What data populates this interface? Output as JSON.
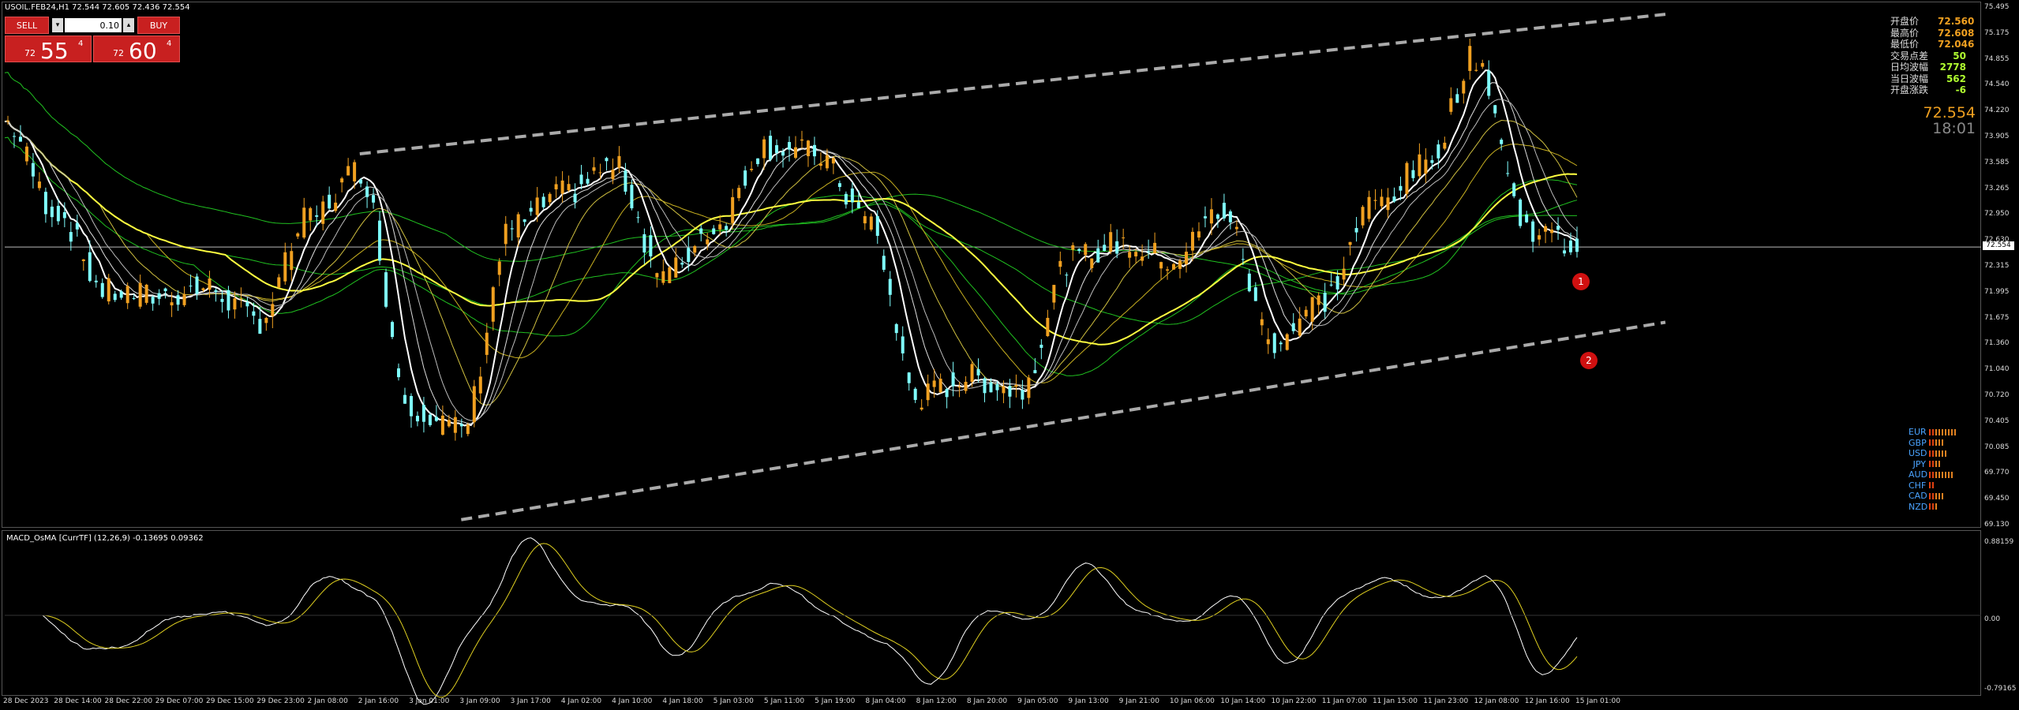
{
  "chart_title": "USOIL.FEB24,H1  72.544 72.605 72.436 72.554",
  "macd_title": "MACD_OsMA [CurrTF] (12,26,9) -0.13695 0.09362",
  "trade": {
    "sell_label": "SELL",
    "buy_label": "BUY",
    "lot": "0.10",
    "lot_down_icon": "▾",
    "lot_up_icon": "▴",
    "bid_small": "72",
    "bid_big": "55",
    "bid_sup": "4",
    "ask_small": "72",
    "ask_big": "60",
    "ask_sup": "4"
  },
  "stats": [
    {
      "label": "开盘价",
      "value": "72.560",
      "color": "#f0a020"
    },
    {
      "label": "最高价",
      "value": "72.608",
      "color": "#f0a020"
    },
    {
      "label": "最低价",
      "value": "72.046",
      "color": "#f0a020"
    },
    {
      "label": "交易点差",
      "value": "50",
      "color": "#b0ff30"
    },
    {
      "label": "日均波幅",
      "value": "2778",
      "color": "#b0ff30"
    },
    {
      "label": "当日波幅",
      "value": "562",
      "color": "#b0ff30"
    },
    {
      "label": "开盘涨跌",
      "value": "-6",
      "color": "#b0ff30"
    }
  ],
  "big_price": "72.554",
  "big_time": "18:01",
  "current_price_tag": "72.554",
  "markers": [
    "1",
    "2"
  ],
  "strength": [
    {
      "name": "EUR",
      "bars": 9
    },
    {
      "name": "GBP",
      "bars": 5
    },
    {
      "name": "USD",
      "bars": 6
    },
    {
      "name": "JPY",
      "bars": 4
    },
    {
      "name": "AUD",
      "bars": 8
    },
    {
      "name": "CHF",
      "bars": 2
    },
    {
      "name": "CAD",
      "bars": 5
    },
    {
      "name": "NZD",
      "bars": 3
    }
  ],
  "price_axis": [
    "75.495",
    "75.175",
    "74.855",
    "74.540",
    "74.220",
    "73.905",
    "73.585",
    "73.265",
    "72.950",
    "72.630",
    "72.315",
    "71.995",
    "71.675",
    "71.360",
    "71.040",
    "70.720",
    "70.405",
    "70.085",
    "69.770",
    "69.450",
    "69.130"
  ],
  "macd_axis": [
    "0.88159",
    "0.00",
    "-0.79165"
  ],
  "time_axis": [
    "28 Dec 2023",
    "28 Dec 14:00",
    "28 Dec 22:00",
    "29 Dec 07:00",
    "29 Dec 15:00",
    "29 Dec 23:00",
    "2 Jan 08:00",
    "2 Jan 16:00",
    "3 Jan 01:00",
    "3 Jan 09:00",
    "3 Jan 17:00",
    "4 Jan 02:00",
    "4 Jan 10:00",
    "4 Jan 18:00",
    "5 Jan 03:00",
    "5 Jan 11:00",
    "5 Jan 19:00",
    "8 Jan 04:00",
    "8 Jan 12:00",
    "8 Jan 20:00",
    "9 Jan 05:00",
    "9 Jan 13:00",
    "9 Jan 21:00",
    "10 Jan 06:00",
    "10 Jan 14:00",
    "10 Jan 22:00",
    "11 Jan 07:00",
    "11 Jan 15:00",
    "11 Jan 23:00",
    "12 Jan 08:00",
    "12 Jan 16:00",
    "15 Jan 01:00"
  ],
  "colors": {
    "bull": "#f0a020",
    "bear": "#7fffff",
    "macd_up": "#ff2020",
    "macd_down": "#30ff30",
    "ma_yellow": "#ffff40",
    "ma_green": "#20c020",
    "channel": "#aaaaaa"
  },
  "chart_data": {
    "type": "candlestick",
    "symbol": "USOIL.FEB24",
    "timeframe": "H1",
    "ylim": [
      69.13,
      75.495
    ],
    "close_path": [
      {
        "t": "28 Dec 2023",
        "p": 74.1
      },
      {
        "t": "28 Dec 14:00",
        "p": 73.0
      },
      {
        "t": "28 Dec 22:00",
        "p": 72.0
      },
      {
        "t": "29 Dec 07:00",
        "p": 71.95
      },
      {
        "t": "29 Dec 15:00",
        "p": 72.05
      },
      {
        "t": "29 Dec 23:00",
        "p": 71.65
      },
      {
        "t": "2 Jan 08:00",
        "p": 72.9
      },
      {
        "t": "2 Jan 16:00",
        "p": 73.5
      },
      {
        "t": "3 Jan 01:00",
        "p": 70.6
      },
      {
        "t": "3 Jan 09:00",
        "p": 70.3
      },
      {
        "t": "3 Jan 17:00",
        "p": 72.8
      },
      {
        "t": "4 Jan 02:00",
        "p": 73.2
      },
      {
        "t": "4 Jan 10:00",
        "p": 73.55
      },
      {
        "t": "4 Jan 18:00",
        "p": 72.2
      },
      {
        "t": "5 Jan 03:00",
        "p": 72.8
      },
      {
        "t": "5 Jan 11:00",
        "p": 73.8
      },
      {
        "t": "5 Jan 19:00",
        "p": 73.7
      },
      {
        "t": "8 Jan 04:00",
        "p": 72.9
      },
      {
        "t": "8 Jan 12:00",
        "p": 70.7
      },
      {
        "t": "8 Jan 20:00",
        "p": 70.95
      },
      {
        "t": "9 Jan 05:00",
        "p": 70.8
      },
      {
        "t": "9 Jan 13:00",
        "p": 72.4
      },
      {
        "t": "9 Jan 21:00",
        "p": 72.6
      },
      {
        "t": "10 Jan 06:00",
        "p": 72.4
      },
      {
        "t": "10 Jan 14:00",
        "p": 73.0
      },
      {
        "t": "10 Jan 22:00",
        "p": 71.4
      },
      {
        "t": "11 Jan 07:00",
        "p": 71.9
      },
      {
        "t": "11 Jan 15:00",
        "p": 73.1
      },
      {
        "t": "11 Jan 23:00",
        "p": 73.55
      },
      {
        "t": "12 Jan 08:00",
        "p": 74.9
      },
      {
        "t": "12 Jan 16:00",
        "p": 72.8
      },
      {
        "t": "15 Jan 01:00",
        "p": 72.55
      }
    ],
    "channel_upper": [
      {
        "t": "2 Jan 16:00",
        "p": 73.7
      },
      {
        "t": "15 Jan 01:00",
        "p": 75.3
      }
    ],
    "channel_lower": [
      {
        "t": "3 Jan 09:00",
        "p": 69.2
      },
      {
        "t": "15 Jan 01:00",
        "p": 71.45
      }
    ],
    "current_price": 72.554
  }
}
